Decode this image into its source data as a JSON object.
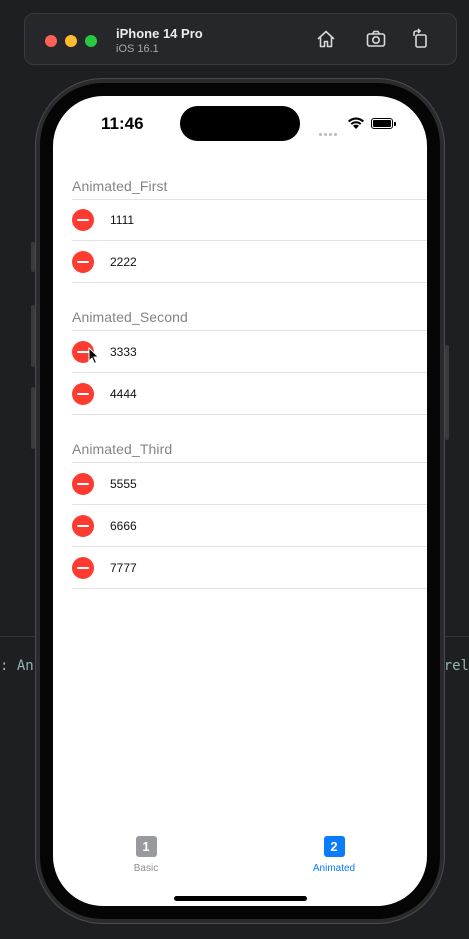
{
  "simulator": {
    "device_name": "iPhone 14 Pro",
    "os_version": "iOS 16.1",
    "code_left": ": An",
    "code_right": "rel"
  },
  "status_bar": {
    "time": "11:46"
  },
  "sections": [
    {
      "header": "Animated_First",
      "rows": [
        "1111",
        "2222"
      ]
    },
    {
      "header": "Animated_Second",
      "rows": [
        "3333",
        "4444"
      ]
    },
    {
      "header": "Animated_Third",
      "rows": [
        "5555",
        "6666",
        "7777"
      ]
    }
  ],
  "tabs": [
    {
      "icon_text": "1",
      "label": "Basic",
      "selected": false
    },
    {
      "icon_text": "2",
      "label": "Animated",
      "selected": true
    }
  ],
  "colors": {
    "delete_red": "#fe3b30",
    "accent_blue": "#0a7aff"
  }
}
